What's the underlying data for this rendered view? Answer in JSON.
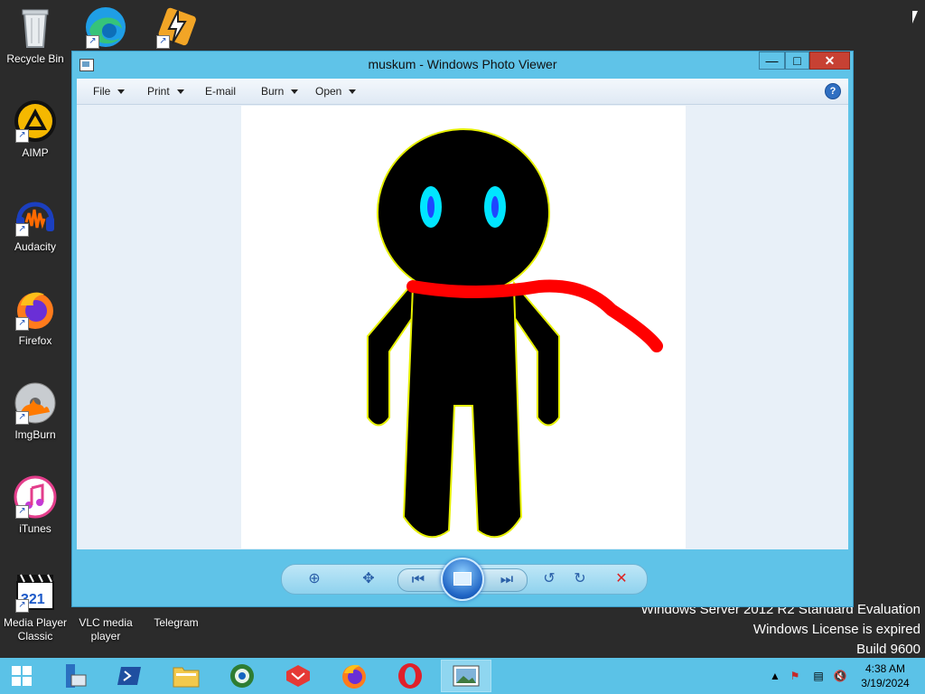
{
  "desktop": {
    "icons": [
      {
        "label": "Recycle Bin"
      },
      {
        "label": ""
      },
      {
        "label": ""
      },
      {
        "label": "AIMP"
      },
      {
        "label": "Audacity"
      },
      {
        "label": "Firefox"
      },
      {
        "label": "ImgBurn"
      },
      {
        "label": "iTunes"
      },
      {
        "label": "Media Player Classic"
      },
      {
        "label": "VLC media player"
      },
      {
        "label": "Telegram"
      }
    ],
    "watermark": {
      "line1": "Windows Server 2012 R2 Standard Evaluation",
      "line2": "Windows License is expired",
      "line3": "Build 9600"
    }
  },
  "window": {
    "title": "muskum - Windows Photo Viewer",
    "menu": {
      "file": "File",
      "print": "Print",
      "email": "E-mail",
      "burn": "Burn",
      "open": "Open"
    },
    "help_glyph": "?",
    "controls": {
      "zoom": "zoom-icon",
      "fit": "actual-size-icon",
      "previous": "previous-icon",
      "slideshow": "slideshow-icon",
      "next": "next-icon",
      "rotate_ccw": "rotate-left-icon",
      "rotate_cw": "rotate-right-icon",
      "delete": "delete-icon"
    }
  },
  "taskbar": {
    "time": "4:38 AM",
    "date": "3/19/2024"
  },
  "colors": {
    "window_frame": "#5fc3e8",
    "taskbar": "#5bc2e7",
    "close_button": "#c74133",
    "scarf": "#ff0000",
    "eyes": "#00e5ff"
  }
}
